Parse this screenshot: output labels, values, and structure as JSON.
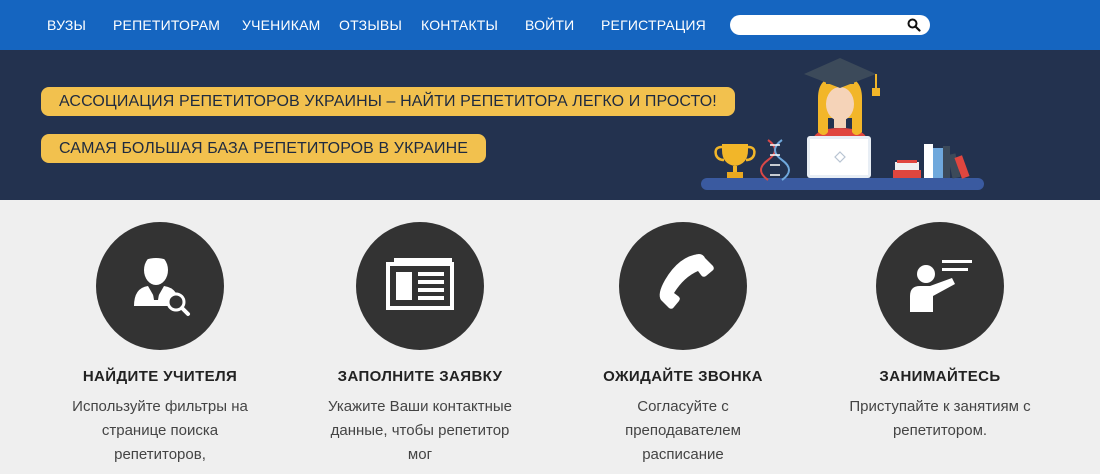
{
  "nav": {
    "items": [
      "ВУЗЫ",
      "РЕПЕТИТОРАМ",
      "УЧЕНИКАМ",
      "ОТЗЫВЫ",
      "КОНТАКТЫ",
      "ВОЙТИ",
      "РЕГИСТРАЦИЯ"
    ],
    "search": {
      "value": "",
      "placeholder": "",
      "icon": "search-icon"
    }
  },
  "banner": {
    "headline": "АССОЦИАЦИЯ РЕПЕТИТОРОВ УКРАИНЫ – НАЙТИ РЕПЕТИТОРА ЛЕГКО И ПРОСТО!",
    "subheadline": "САМАЯ БОЛЬШАЯ БАЗА РЕПЕТИТОРОВ В УКРАИНЕ",
    "pill_color": "#f2c14e",
    "background_color": "#23324f"
  },
  "steps": [
    {
      "icon": "find-teacher-icon",
      "title": "НАЙДИТЕ УЧИТЕЛЯ",
      "text": "Используйте фильтры на странице поиска репетиторов,"
    },
    {
      "icon": "application-form-icon",
      "title": "ЗАПОЛНИТЕ ЗАЯВКУ",
      "text": "Укажите Ваши контактные данные, чтобы репетитор мог"
    },
    {
      "icon": "phone-icon",
      "title": "ОЖИДАЙТЕ ЗВОНКА",
      "text": "Согласуйте с преподавателем расписание"
    },
    {
      "icon": "teacher-board-icon",
      "title": "ЗАНИМАЙТЕСЬ",
      "text": "Приступайте к занятиям с репетитором."
    }
  ],
  "colors": {
    "nav": "#1565c0",
    "circle": "#333333",
    "page_bg": "#efefef"
  }
}
